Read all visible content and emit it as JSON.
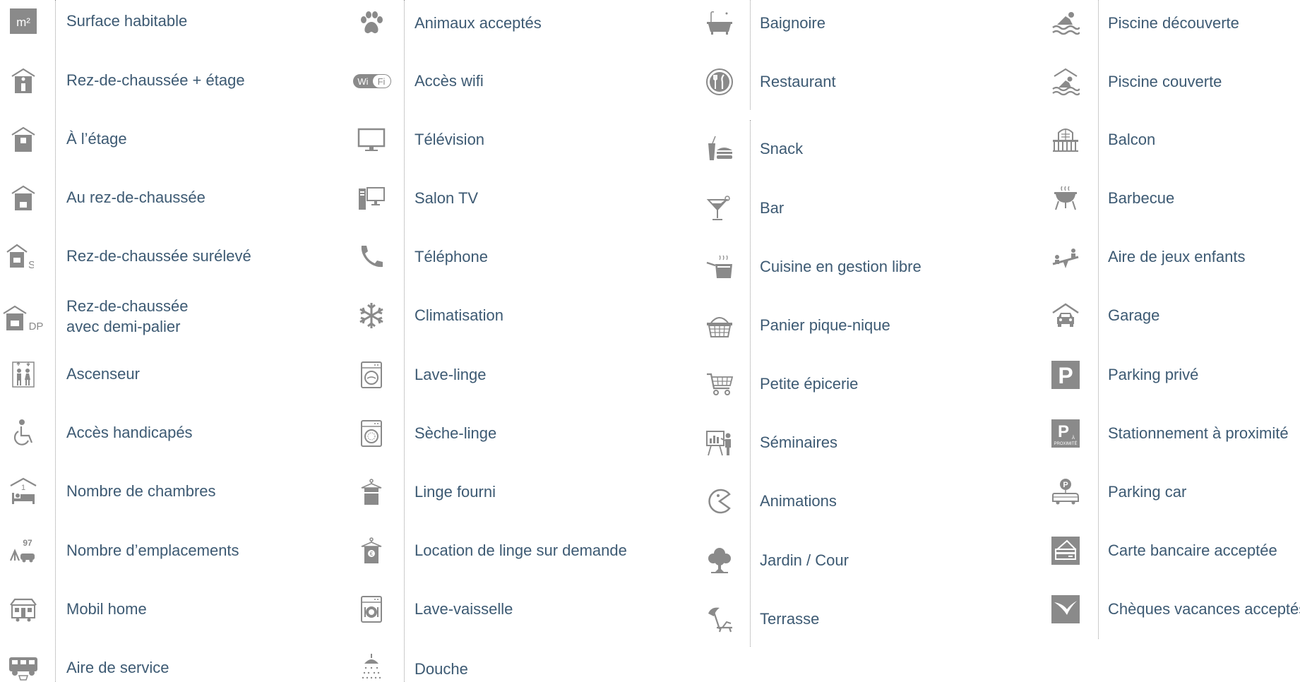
{
  "columns": [
    {
      "items": [
        {
          "label": "Surface habitable",
          "icon": "surface-m2-icon",
          "badge": "m²"
        },
        {
          "label": "Rez-de-chaussée + étage",
          "icon": "house-two-floors-icon"
        },
        {
          "label": "À  l’étage",
          "icon": "house-upper-floor-icon"
        },
        {
          "label": "Au rez-de-chaussée",
          "icon": "house-ground-floor-icon"
        },
        {
          "label": "Rez-de-chaussée surélevé",
          "icon": "house-raised-ground-icon",
          "badge": "S"
        },
        {
          "label": "Rez-de-chaussée",
          "label2": "avec demi-palier",
          "icon": "house-half-landing-icon",
          "badge": "DP"
        },
        {
          "label": "Ascenseur",
          "icon": "elevator-icon"
        },
        {
          "label": "Accès handicapés",
          "icon": "wheelchair-icon"
        },
        {
          "label": "Nombre de chambres",
          "icon": "bedrooms-icon",
          "badge": "1"
        },
        {
          "label": "Nombre d’emplacements",
          "icon": "pitches-icon",
          "badge": "97"
        },
        {
          "label": "Mobil home",
          "icon": "mobile-home-icon"
        },
        {
          "label": "Aire de service",
          "icon": "camper-service-icon"
        }
      ]
    },
    {
      "items": [
        {
          "label": "Animaux acceptés",
          "icon": "paw-icon"
        },
        {
          "label": "Accès wifi",
          "icon": "wifi-icon",
          "badge": "Wi Fi"
        },
        {
          "label": "Télévision",
          "icon": "television-icon"
        },
        {
          "label": "Salon TV",
          "icon": "tv-lounge-icon"
        },
        {
          "label": "Téléphone",
          "icon": "telephone-icon"
        },
        {
          "label": "Climatisation",
          "icon": "snowflake-icon"
        },
        {
          "label": "Lave-linge",
          "icon": "washing-machine-icon"
        },
        {
          "label": "Sèche-linge",
          "icon": "dryer-icon"
        },
        {
          "label": "Linge fourni",
          "icon": "linen-icon"
        },
        {
          "label": "Location de linge sur demande",
          "icon": "linen-rental-icon",
          "badge": "€"
        },
        {
          "label": "Lave-vaisselle",
          "icon": "dishwasher-icon"
        },
        {
          "label": "Douche",
          "icon": "shower-icon"
        }
      ]
    },
    {
      "items": [
        {
          "label": "Baignoire",
          "icon": "bathtub-icon"
        },
        {
          "label": "Restaurant",
          "icon": "restaurant-icon"
        },
        {
          "label": "Snack",
          "icon": "snack-icon"
        },
        {
          "label": "Bar",
          "icon": "cocktail-icon"
        },
        {
          "label": "Cuisine en gestion libre",
          "icon": "cooking-pot-icon"
        },
        {
          "label": "Panier pique-nique",
          "icon": "picnic-basket-icon"
        },
        {
          "label": "Petite épicerie",
          "icon": "shopping-cart-icon"
        },
        {
          "label": "Séminaires",
          "icon": "seminar-icon"
        },
        {
          "label": "Animations",
          "icon": "animations-icon"
        },
        {
          "label": "Jardin / Cour",
          "icon": "tree-icon"
        },
        {
          "label": "Terrasse",
          "icon": "terrace-icon"
        }
      ]
    },
    {
      "items": [
        {
          "label": "Piscine découverte",
          "icon": "outdoor-pool-icon"
        },
        {
          "label": "Piscine couverte",
          "icon": "indoor-pool-icon"
        },
        {
          "label": "Balcon",
          "icon": "balcony-icon"
        },
        {
          "label": "Barbecue",
          "icon": "barbecue-icon"
        },
        {
          "label": "Aire de jeux enfants",
          "icon": "playground-icon"
        },
        {
          "label": "Garage",
          "icon": "garage-icon"
        },
        {
          "label": "Parking privé",
          "icon": "parking-icon",
          "badge": "P"
        },
        {
          "label": "Stationnement à proximité",
          "icon": "parking-nearby-icon",
          "badge": "P",
          "badge2": "À",
          "badge3": "PROXIMITÉ"
        },
        {
          "label": "Parking car",
          "icon": "coach-parking-icon",
          "badge": "P"
        },
        {
          "label": "Carte bancaire acceptée",
          "icon": "credit-card-icon"
        },
        {
          "label": "Chèques vacances acceptés",
          "icon": "holiday-voucher-icon"
        }
      ]
    }
  ],
  "colors": {
    "text": "#3d5a73",
    "icon": "#8a8a8a",
    "divider": "#9a9a9a"
  }
}
